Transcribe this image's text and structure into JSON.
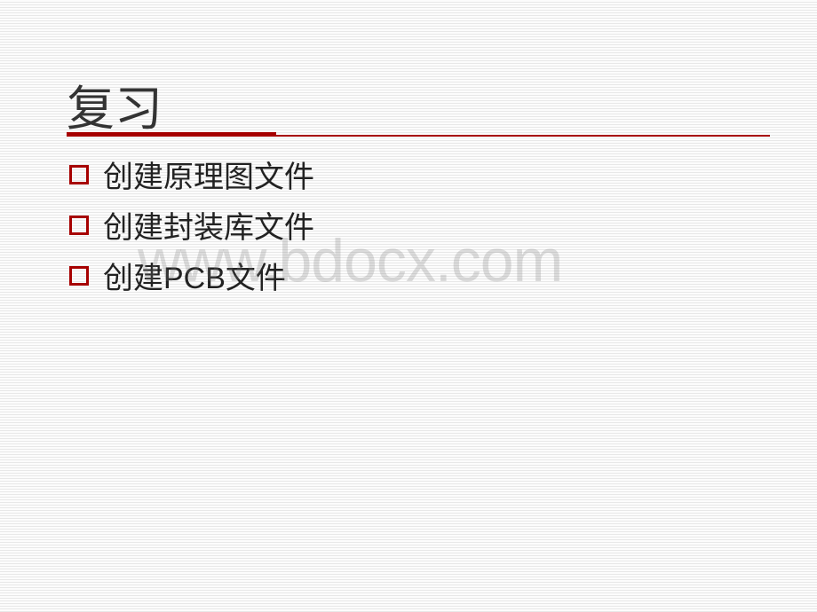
{
  "title": "复习",
  "bullets": [
    {
      "text": "创建原理图文件"
    },
    {
      "text": "创建封装库文件"
    },
    {
      "text": "创建PCB文件"
    }
  ],
  "watermark": "www.bdocx.com",
  "colors": {
    "accent": "#a60000",
    "text": "#222"
  }
}
